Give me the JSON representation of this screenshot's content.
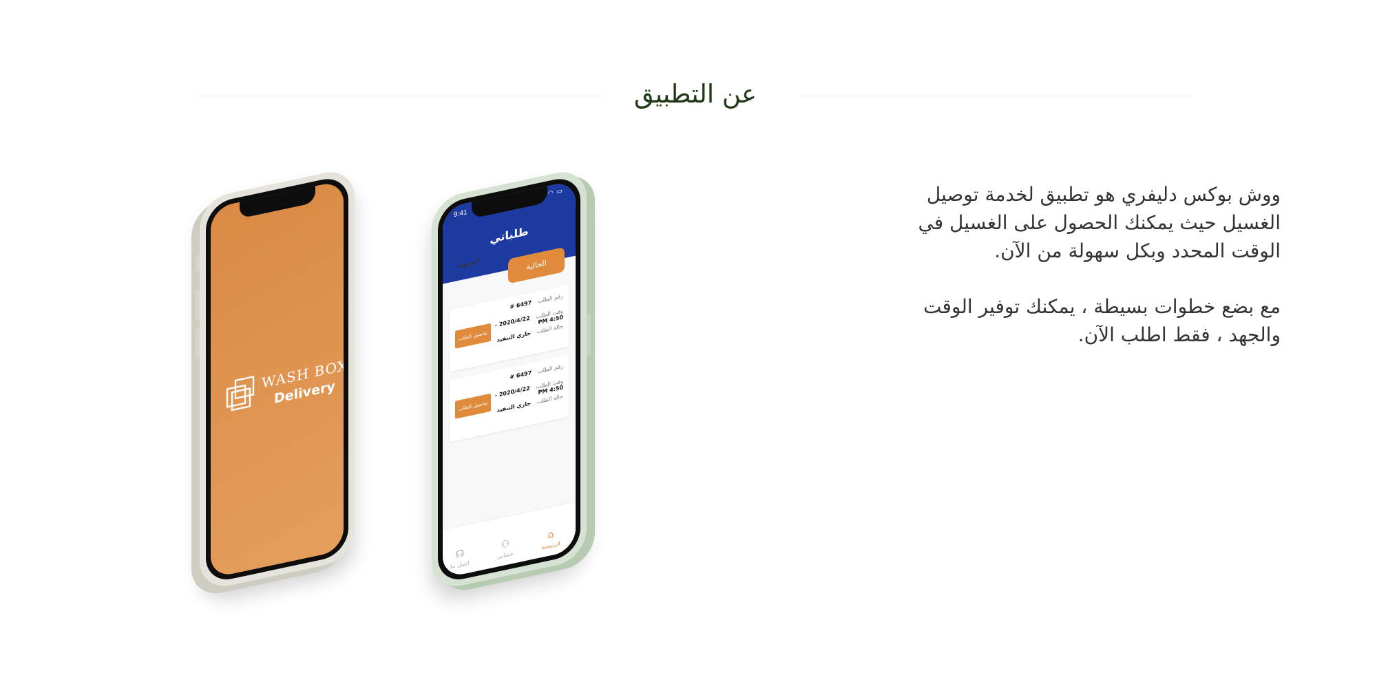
{
  "section": {
    "title": "عن التطبيق"
  },
  "about": {
    "paragraph1": "ووش بوكس دليفري هو تطبيق لخدمة توصيل الغسيل حيث يمكنك الحصول على الغسيل في الوقت المحدد وبكل سهولة من الآن.",
    "paragraph2": "مع بضع خطوات بسيطة ، يمكنك توفير الوقت والجهد ، فقط اطلب الآن."
  },
  "splash_phone": {
    "logo_line1": "WASH BOX",
    "logo_line2": "Delivery",
    "background_color": "#e0924e"
  },
  "app_phone": {
    "status_time": "9:41",
    "status_icons": "▮▮▮ ◠ ▭",
    "header_title": "طلباتي",
    "header_color": "#1d3aa0",
    "accent_color": "#e08a3c",
    "tabs": [
      {
        "label": "الحالية",
        "active": true
      },
      {
        "label": "المنتهية",
        "active": false
      }
    ],
    "orders": [
      {
        "number_label": "رقم الطلب",
        "number_value": "6497 #",
        "time_label": "وقت الطلب",
        "time_value": "2020/4/22 - 4:50 PM",
        "status_label": "حالة الطلب",
        "status_value": "جاري التنفيذ",
        "details_button": "تفاصيل الطلب"
      },
      {
        "number_label": "رقم الطلب",
        "number_value": "6497 #",
        "time_label": "وقت الطلب",
        "time_value": "2020/4/22 - 4:50 PM",
        "status_label": "حالة الطلب",
        "status_value": "جاري التنفيذ",
        "details_button": "تفاصيل الطلب"
      }
    ],
    "bottom_nav": [
      {
        "label": "الرئيسية",
        "icon": "home-icon",
        "active": true
      },
      {
        "label": "حسابي",
        "icon": "user-icon",
        "active": false
      },
      {
        "label": "اتصل بنا",
        "icon": "headset-icon",
        "active": false
      }
    ]
  }
}
